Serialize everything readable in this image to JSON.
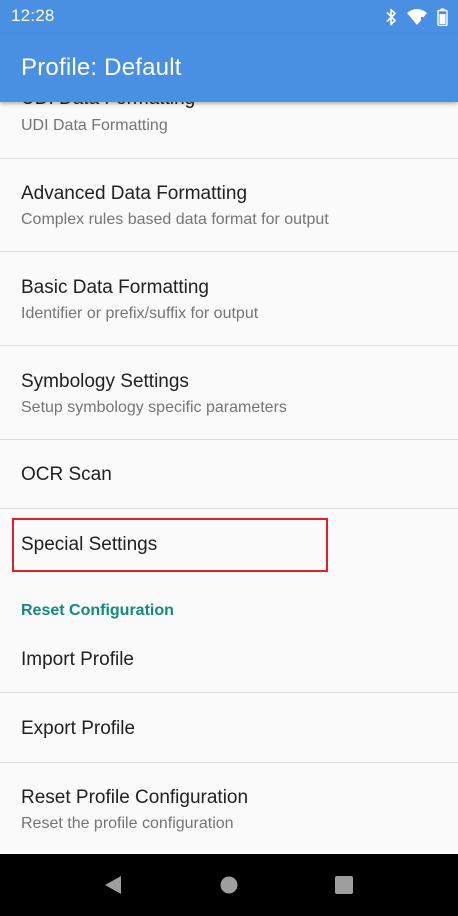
{
  "status_bar": {
    "time": "12:28",
    "icons": [
      "bluetooth-icon",
      "wifi-icon",
      "battery-icon"
    ]
  },
  "app_bar": {
    "title": "Profile: Default"
  },
  "preferences": {
    "udi": {
      "title": "UDI Data Formatting",
      "summary": "UDI Data Formatting"
    },
    "advanced": {
      "title": "Advanced Data Formatting",
      "summary": "Complex rules based data format for output"
    },
    "basic": {
      "title": "Basic Data Formatting",
      "summary": "Identifier or prefix/suffix for output"
    },
    "symbology": {
      "title": "Symbology Settings",
      "summary": "Setup symbology specific parameters"
    },
    "ocr": {
      "title": "OCR Scan"
    },
    "special": {
      "title": "Special Settings"
    }
  },
  "reset_section": {
    "header": "Reset Configuration",
    "import": {
      "title": "Import Profile"
    },
    "export": {
      "title": "Export Profile"
    },
    "reset": {
      "title": "Reset Profile Configuration",
      "summary": "Reset the profile configuration"
    }
  },
  "nav_bar": {
    "buttons": [
      "back-icon",
      "home-icon",
      "recents-icon"
    ]
  },
  "colors": {
    "primary": "#4a90e2",
    "accent": "#138a7a",
    "highlight": "#e2202c"
  }
}
